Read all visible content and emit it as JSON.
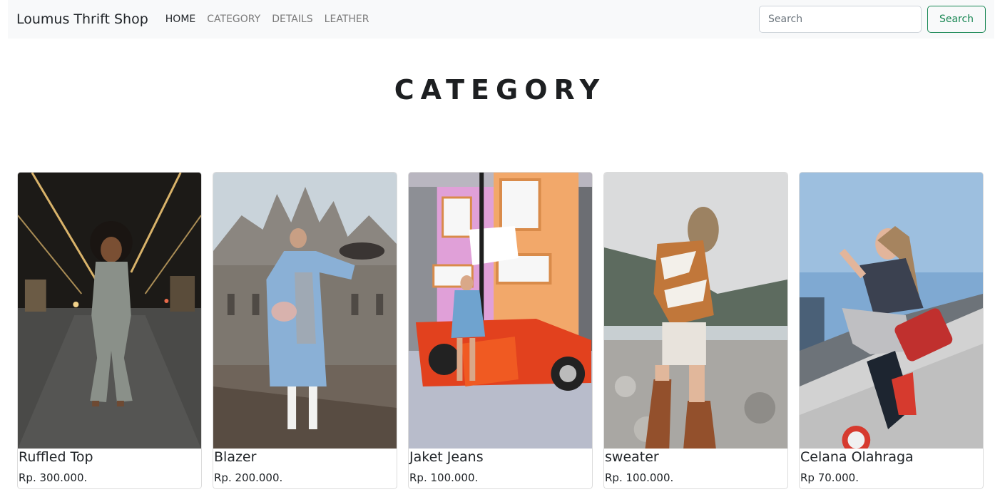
{
  "navbar": {
    "brand": "Loumus Thrift Shop",
    "links": [
      {
        "label": "HOME",
        "active": true
      },
      {
        "label": "CATEGORY",
        "active": false
      },
      {
        "label": "DETAILS",
        "active": false
      },
      {
        "label": "LEATHER",
        "active": false
      }
    ],
    "search": {
      "placeholder": "Search",
      "value": "",
      "button_label": "Search"
    }
  },
  "main": {
    "title": "CATEGORY",
    "products": [
      {
        "name": "Ruffled Top",
        "price": "Rp. 300.000."
      },
      {
        "name": "Blazer",
        "price": "Rp. 200.000."
      },
      {
        "name": "Jaket Jeans",
        "price": "Rp. 100.000."
      },
      {
        "name": "sweater",
        "price": "Rp. 100.000."
      },
      {
        "name": "Celana Olahraga",
        "price": "Rp 70.000."
      }
    ]
  },
  "colors": {
    "navbar_bg": "#f8f9fa",
    "search_button": "#198754",
    "nav_inactive": "#7a7a7a",
    "text": "#212529"
  }
}
